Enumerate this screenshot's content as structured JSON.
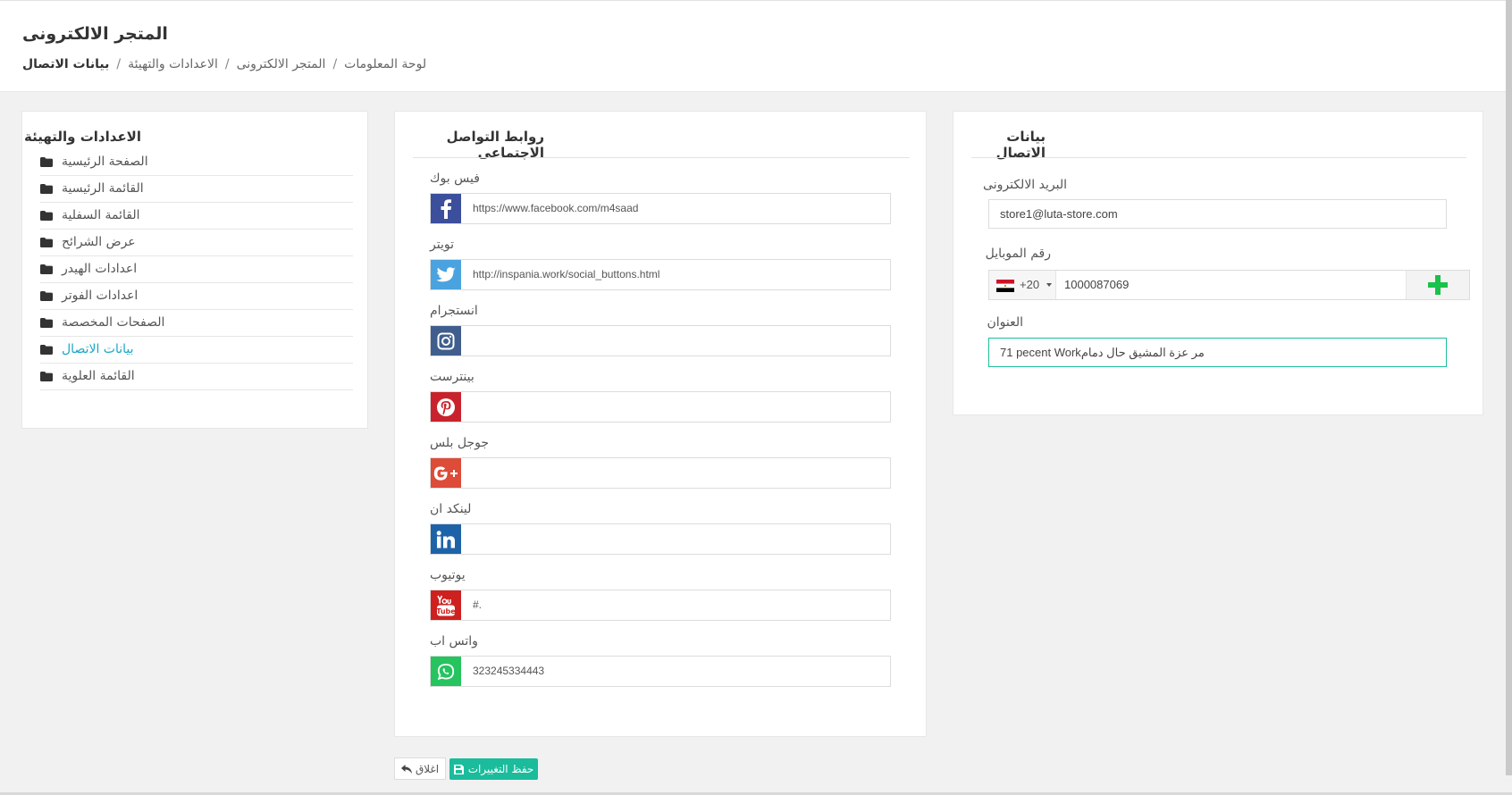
{
  "header": {
    "title": "المتجر الالكترونى",
    "breadcrumb": [
      "لوحة المعلومات",
      "المتجر الالكترونى",
      "الاعدادات والتهيئة",
      "بيانات الاتصال"
    ],
    "separator": "/"
  },
  "menu": {
    "title": "الاعدادات والتهيئة",
    "items": [
      {
        "label": "الصفحة الرئيسية",
        "active": false
      },
      {
        "label": "القائمة الرئيسية",
        "active": false
      },
      {
        "label": "القائمة السفلية",
        "active": false
      },
      {
        "label": "عرض الشرائح",
        "active": false
      },
      {
        "label": "اعدادات الهيدر",
        "active": false
      },
      {
        "label": "اعدادات الفوتر",
        "active": false
      },
      {
        "label": "الصفحات المخصصة",
        "active": false
      },
      {
        "label": "بيانات الاتصال",
        "active": true
      },
      {
        "label": "القائمة العلوية",
        "active": false
      }
    ]
  },
  "social": {
    "title": "روابط التواصل الاجتماعى",
    "items": [
      {
        "label": "فيس بوك",
        "value": "https://www.facebook.com/m4saad",
        "icon": "facebook-icon",
        "color": "#3b4f9c"
      },
      {
        "label": "تويتر",
        "value": "http://inspania.work/social_buttons.html",
        "icon": "twitter-icon",
        "color": "#4aa3df"
      },
      {
        "label": "انستجرام",
        "value": "",
        "icon": "instagram-icon",
        "color": "#3f5e8d"
      },
      {
        "label": "بينترست",
        "value": "",
        "icon": "pinterest-icon",
        "color": "#c8232c"
      },
      {
        "label": "جوجل بلس",
        "value": "",
        "icon": "google-plus-icon",
        "color": "#dd4b39"
      },
      {
        "label": "لينكد ان",
        "value": "",
        "icon": "linkedin-icon",
        "color": "#1e63a8"
      },
      {
        "label": "يوتيوب",
        "value": "#.",
        "icon": "youtube-icon",
        "color": "#cd201f"
      },
      {
        "label": "واتس اب",
        "value": "323245334443",
        "icon": "whatsapp-icon",
        "color": "#25c45f"
      }
    ]
  },
  "contact": {
    "title": "بيانات الاتصال",
    "email_label": "البريد الالكترونى",
    "email_value": "store1@luta-store.com",
    "mobile_label": "رقم الموبايل",
    "dial_code": "+20",
    "mobile_value": "1000087069",
    "address_label": "العنوان",
    "address_value": "71 pecent Workمر عزة المشيق حال دمام"
  },
  "actions": {
    "close_label": "اغلاق",
    "save_label": "حفظ التغييرات"
  },
  "colors": {
    "accent": "#1abc9c",
    "active_link": "#1aa7c7",
    "add_green": "#19c24a"
  }
}
